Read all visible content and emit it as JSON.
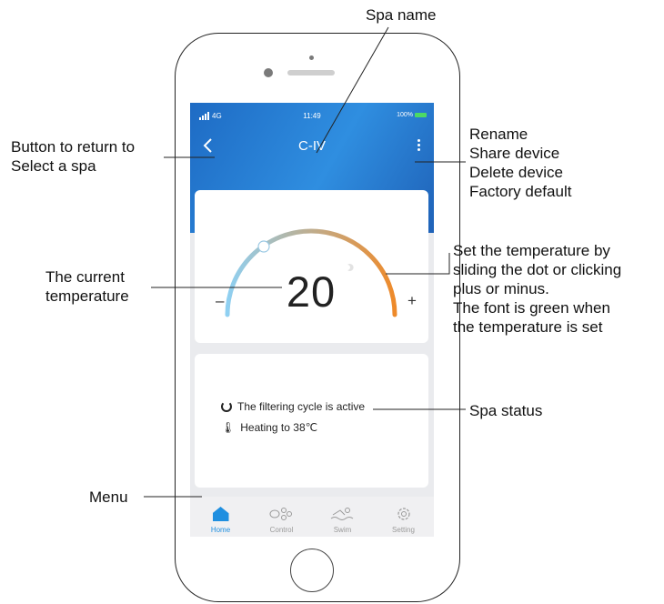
{
  "phone": {
    "status": {
      "network": "4G",
      "time": "11:49",
      "battery": "100%"
    },
    "header": {
      "title": "C-IV",
      "back_icon": "chevron-left-icon",
      "more_icon": "more-vertical-icon"
    },
    "temperature": {
      "current": "20",
      "minus_label": "–",
      "plus_label": "+",
      "dial_start_color": "#8fd0f2",
      "dial_end_color": "#ee8a2a"
    },
    "status_card": {
      "items": [
        {
          "icon": "filter-cycle-icon",
          "text": "The filtering cycle is active"
        },
        {
          "icon": "thermometer-icon",
          "text": "Heating to 38℃"
        }
      ]
    },
    "nav": {
      "items": [
        {
          "label": "Home",
          "icon": "home-icon",
          "active": true
        },
        {
          "label": "Control",
          "icon": "control-icon",
          "active": false
        },
        {
          "label": "Swim",
          "icon": "swim-icon",
          "active": false
        },
        {
          "label": "Setting",
          "icon": "gear-icon",
          "active": false
        }
      ],
      "active_color": "#1f8fe0"
    }
  },
  "annotations": {
    "spa_name": "Spa name",
    "back_button": [
      "Button to return to",
      "Select a spa"
    ],
    "menu_options": [
      "Rename",
      "Share device",
      "Delete device",
      "Factory default"
    ],
    "current_temp": [
      "The current",
      "temperature"
    ],
    "set_temp": [
      "Set the temperature by",
      "sliding the dot or clicking",
      "plus or minus.",
      "The font is green when",
      "the temperature is set"
    ],
    "spa_status": "Spa status",
    "menu": "Menu"
  }
}
